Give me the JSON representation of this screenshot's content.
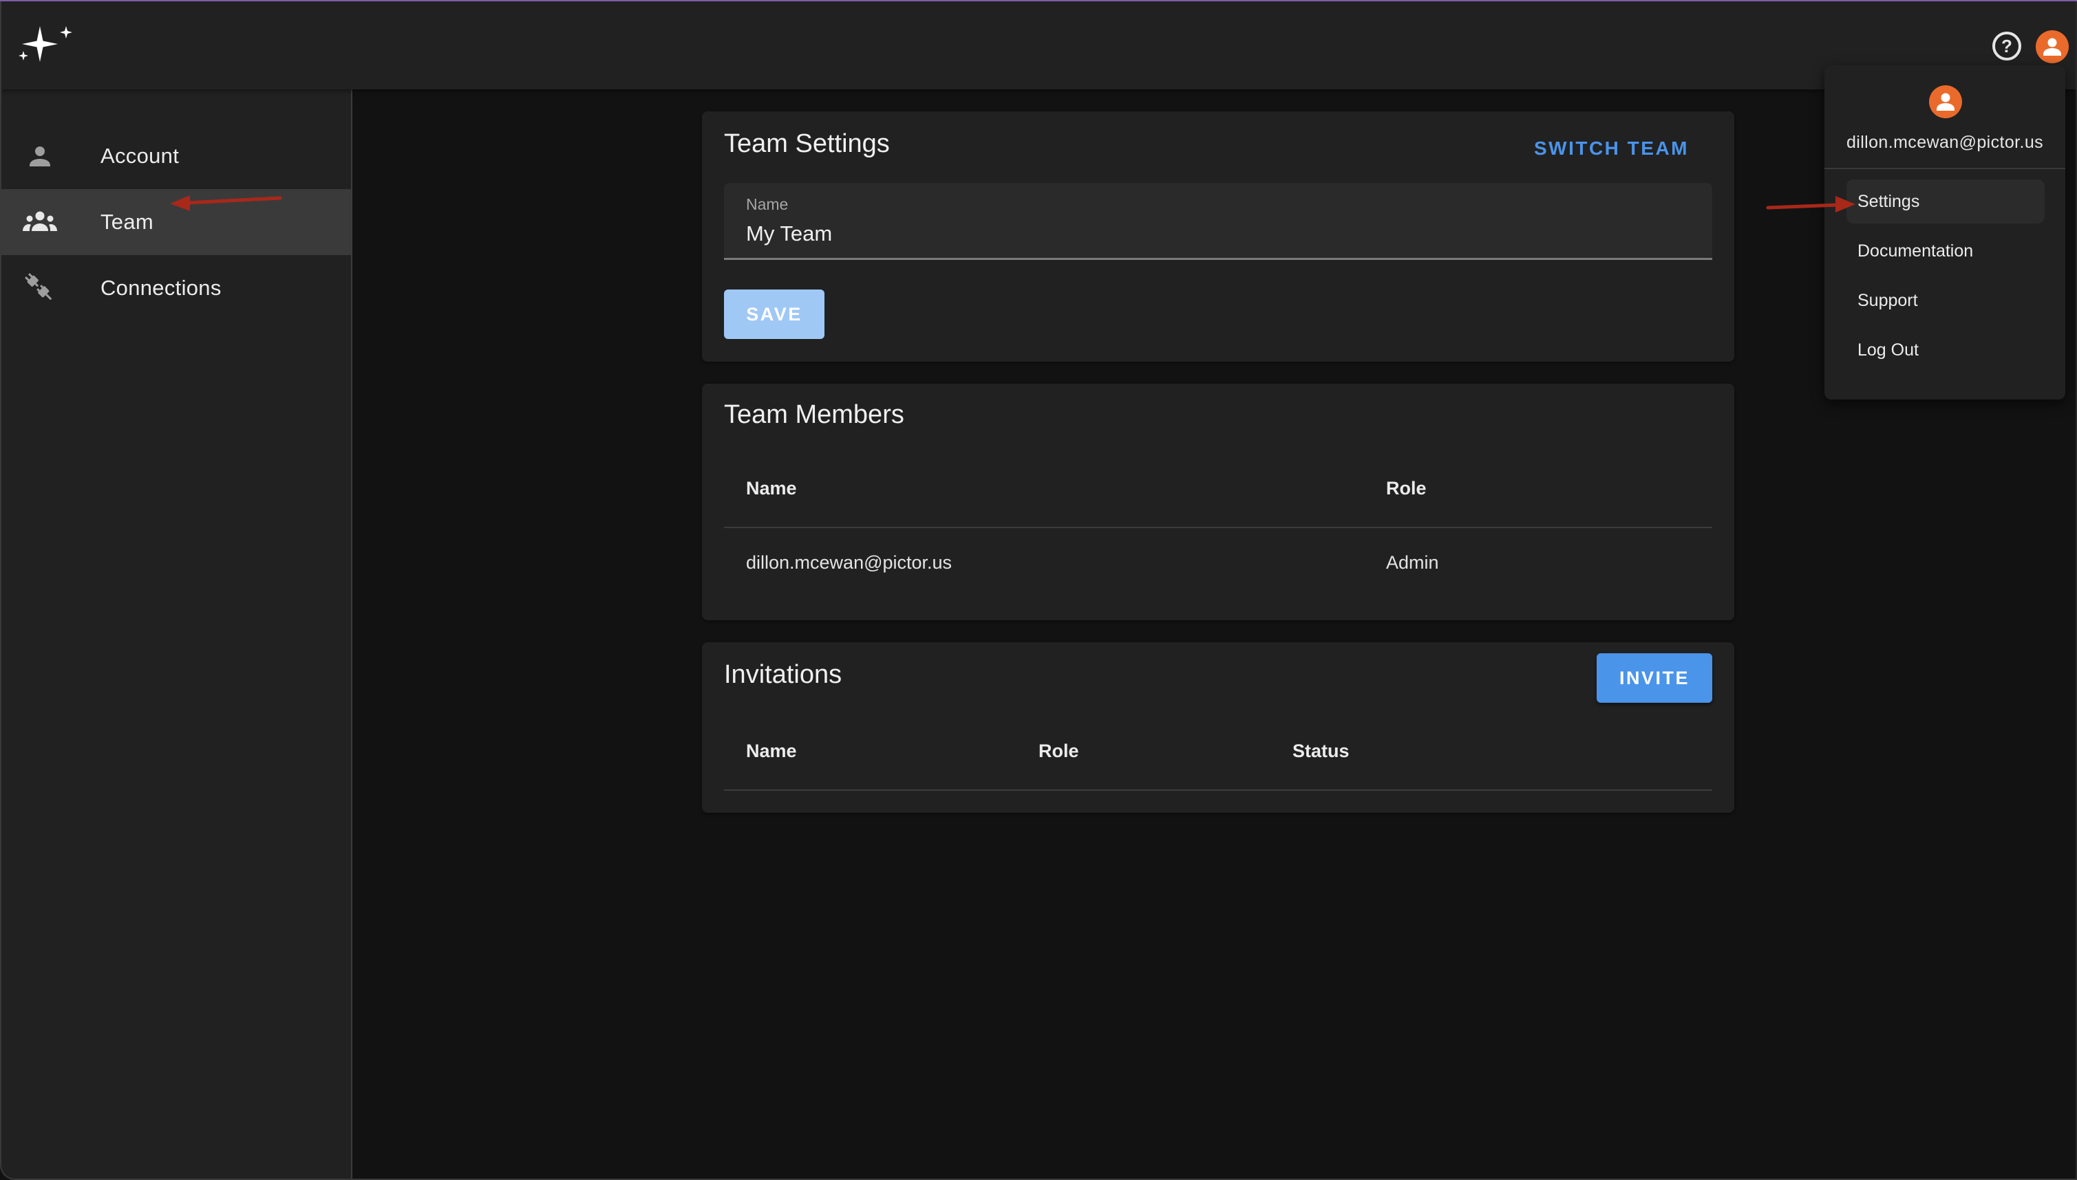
{
  "app": {
    "logo_icon": "sparkles-icon",
    "help_icon": "help-circle-icon",
    "account_icon": "account-circle-icon"
  },
  "colors": {
    "accent": "#4a94ea",
    "accent_disabled": "#9fc8f5",
    "avatar": "#ea6a2c",
    "annotation_arrow": "#a8281a",
    "surface": "#212121",
    "background": "#121212",
    "window_top_line": "#7b5ea7"
  },
  "sidebar": {
    "items": [
      {
        "label": "Account",
        "icon": "person-icon",
        "active": false
      },
      {
        "label": "Team",
        "icon": "group-icon",
        "active": true
      },
      {
        "label": "Connections",
        "icon": "plug-icon",
        "active": false
      }
    ]
  },
  "team_settings": {
    "title": "Team Settings",
    "switch_team_label": "SWITCH TEAM",
    "name_field": {
      "label": "Name",
      "value": "My Team"
    },
    "save_label": "SAVE",
    "save_disabled": true
  },
  "team_members": {
    "title": "Team Members",
    "columns": [
      "Name",
      "Role"
    ],
    "rows": [
      {
        "name": "dillon.mcewan@pictor.us",
        "role": "Admin"
      }
    ]
  },
  "invitations": {
    "title": "Invitations",
    "invite_label": "INVITE",
    "columns": [
      "Name",
      "Role",
      "Status"
    ],
    "rows": []
  },
  "user_menu": {
    "email": "dillon.mcewan@pictor.us",
    "items": [
      {
        "label": "Settings",
        "highlighted": true
      },
      {
        "label": "Documentation",
        "highlighted": false
      },
      {
        "label": "Support",
        "highlighted": false
      },
      {
        "label": "Log Out",
        "highlighted": false
      }
    ]
  },
  "annotations": [
    {
      "type": "arrow",
      "points_to": "sidebar-item-team"
    },
    {
      "type": "arrow",
      "points_to": "menu-item-settings"
    }
  ]
}
